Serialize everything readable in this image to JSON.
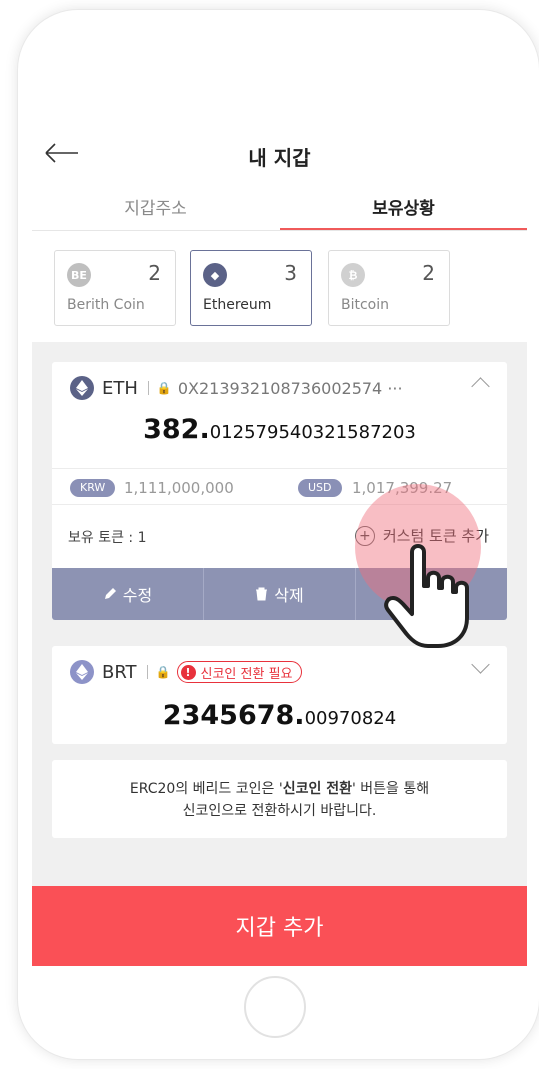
{
  "header": {
    "title": "내 지갑"
  },
  "tabs": [
    {
      "label": "지갑주소"
    },
    {
      "label": "보유상황"
    }
  ],
  "coins": [
    {
      "name": "Berith Coin",
      "count": "2",
      "icon": "berith-coin-icon",
      "glyph": "BE",
      "color": "#bfbfbf"
    },
    {
      "name": "Ethereum",
      "count": "3",
      "icon": "ethereum-icon",
      "glyph": "◆",
      "color": "#5b6287"
    },
    {
      "name": "Bitcoin",
      "count": "2",
      "icon": "bitcoin-icon",
      "glyph": "₿",
      "color": "#d0d0d0"
    }
  ],
  "eth_card": {
    "symbol": "ETH",
    "address": "0X213932108736002574 ···",
    "balance_int": "382.",
    "balance_dec": "012579540321587203",
    "krw_label": "KRW",
    "krw_value": "1,111,000,000",
    "usd_label": "USD",
    "usd_value": "1,017,399.27",
    "held_tokens": "보유 토큰 : 1",
    "add_custom_token": "커스텀 토큰 추가",
    "actions": {
      "edit": "수정",
      "delete": "삭제"
    }
  },
  "brt_card": {
    "symbol": "BRT",
    "warning": "신코인 전환 필요",
    "balance_int": "2345678.",
    "balance_dec": "00970824"
  },
  "notice": {
    "line1_a": "ERC20의 베리드 코인은 '",
    "line1_b": "신코인 전환",
    "line1_c": "' 버튼을 통해",
    "line2": "신코인으로 전환하시기 바랍니다."
  },
  "cta": {
    "label": "지갑 추가"
  },
  "colors": {
    "accent": "#fa5056",
    "action_bar": "#8d93b3",
    "warning": "#e8323c"
  }
}
